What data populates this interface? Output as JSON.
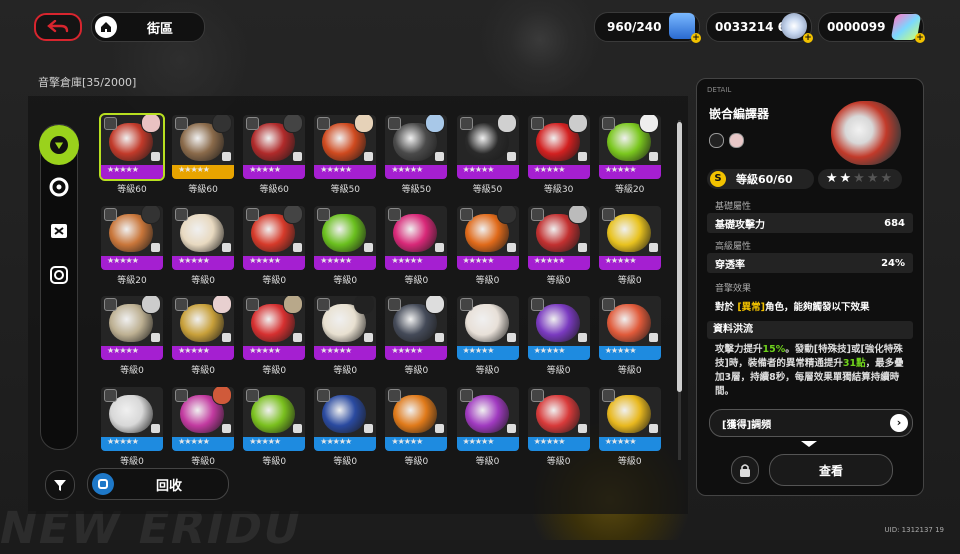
{
  "colors": {
    "accent_green": "#9ad21c",
    "back_red": "#d8252e",
    "strip_purple": "#a51fd1",
    "strip_blue": "#1e8be0",
    "strip_yellow": "#e8a400"
  },
  "topbar": {
    "home_label": "街區",
    "battery": "960/240",
    "coins": "0033214 69",
    "polychrome": "0000099"
  },
  "storage": {
    "title": "音擎倉庫[35/2000]"
  },
  "recycle_label": "回收",
  "cards": [
    {
      "level": "等級60",
      "rank": "purple",
      "art": "#c23a2a",
      "avatar": "#e9c2c2",
      "sel": true
    },
    {
      "level": "等級60",
      "rank": "yellow",
      "art": "#8a6a4a",
      "avatar": "#333333"
    },
    {
      "level": "等級60",
      "rank": "purple",
      "art": "#b02a2a",
      "avatar": "#444444"
    },
    {
      "level": "等級50",
      "rank": "purple",
      "art": "#cf4a1f",
      "avatar": "#e6d2b8"
    },
    {
      "level": "等級50",
      "rank": "purple",
      "art": "#4a4a4a",
      "avatar": "#a8c8e8"
    },
    {
      "level": "等級50",
      "rank": "purple",
      "art": "#2a2a2a",
      "avatar": "#d0d0d0"
    },
    {
      "level": "等級30",
      "rank": "purple",
      "art": "#d22020",
      "avatar": "#cccccc"
    },
    {
      "level": "等級20",
      "rank": "purple",
      "art": "#7ac71e",
      "avatar": "#eeeeee"
    },
    {
      "level": "等級20",
      "rank": "purple",
      "art": "#c9763a",
      "avatar": "#333333"
    },
    {
      "level": "等級0",
      "rank": "purple",
      "art": "#e8d9c0",
      "avatar": ""
    },
    {
      "level": "等級0",
      "rank": "purple",
      "art": "#d63a2a",
      "avatar": "#444444"
    },
    {
      "level": "等級0",
      "rank": "purple",
      "art": "#6ac01e",
      "avatar": ""
    },
    {
      "level": "等級0",
      "rank": "purple",
      "art": "#d82878",
      "avatar": ""
    },
    {
      "level": "等級0",
      "rank": "purple",
      "art": "#e06a1a",
      "avatar": "#333333"
    },
    {
      "level": "等級0",
      "rank": "purple",
      "art": "#c23030",
      "avatar": "#bbbbbb"
    },
    {
      "level": "等級0",
      "rank": "purple",
      "art": "#e8c21e",
      "avatar": ""
    },
    {
      "level": "等級0",
      "rank": "purple",
      "art": "#bdb092",
      "avatar": "#cccccc"
    },
    {
      "level": "等級0",
      "rank": "purple",
      "art": "#c8a03a",
      "avatar": "#e8d0d0"
    },
    {
      "level": "等級0",
      "rank": "purple",
      "art": "#d63030",
      "avatar": "#b8a88a"
    },
    {
      "level": "等級0",
      "rank": "purple",
      "art": "#e8e0d0",
      "avatar": "#222222"
    },
    {
      "level": "等級0",
      "rank": "purple",
      "art": "#444a58",
      "avatar": "#dddddd"
    },
    {
      "level": "等級0",
      "rank": "blue",
      "art": "#e8e0d8",
      "avatar": ""
    },
    {
      "level": "等級0",
      "rank": "blue",
      "art": "#7a3ac0",
      "avatar": ""
    },
    {
      "level": "等級0",
      "rank": "blue",
      "art": "#e05a3a",
      "avatar": ""
    },
    {
      "level": "等級0",
      "rank": "blue",
      "art": "#d8d8d8",
      "avatar": ""
    },
    {
      "level": "等級0",
      "rank": "blue",
      "art": "#c23aa0",
      "avatar": "#d05a3a"
    },
    {
      "level": "等級0",
      "rank": "blue",
      "art": "#7ac01e",
      "avatar": ""
    },
    {
      "level": "等級0",
      "rank": "blue",
      "art": "#2a4aa0",
      "avatar": ""
    },
    {
      "level": "等級0",
      "rank": "blue",
      "art": "#e07a1a",
      "avatar": ""
    },
    {
      "level": "等級0",
      "rank": "blue",
      "art": "#a03ac0",
      "avatar": ""
    },
    {
      "level": "等級0",
      "rank": "blue",
      "art": "#d83a3a",
      "avatar": ""
    },
    {
      "level": "等級0",
      "rank": "blue",
      "art": "#e8b81e",
      "avatar": ""
    }
  ],
  "detail": {
    "tag": "DETAIL",
    "name": "嵌合編譯器",
    "level": "等級60/60",
    "stars": "★★★★★",
    "base_section": "基礎屬性",
    "base_stat_label": "基礎攻擊力",
    "base_stat_value": "684",
    "adv_section": "高級屬性",
    "adv_stat_label": "穿透率",
    "adv_stat_value": "24%",
    "effect_section": "音擎效果",
    "effect_target_prefix": "對於 ",
    "effect_target_tag": "[異常]",
    "effect_target_suffix": "角色，能夠觸發以下效果",
    "effect_title": "資料洪流",
    "desc_1": "攻擊力提升",
    "desc_pct": "15%",
    "desc_2": "。發動[特殊技]或[強化特殊技]時，裝備者的異常精通提升",
    "desc_pts": "31點",
    "desc_3": "，最多疊加3層，持續8秒，每層效果單獨結算持續時間。",
    "source": "[獲得]調頻",
    "view_button": "查看"
  },
  "uid": "UID: 1312137 19"
}
